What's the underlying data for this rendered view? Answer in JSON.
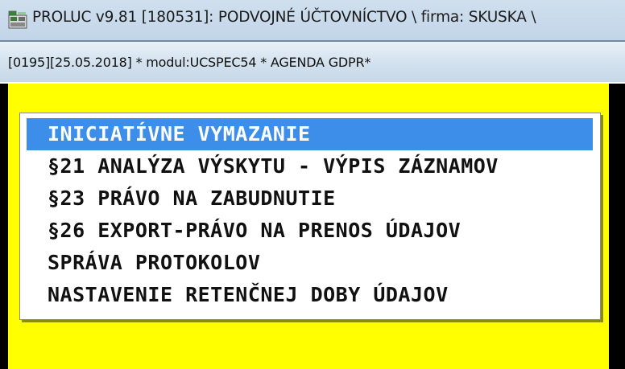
{
  "window": {
    "title": "PROLUC v9.81 [180531]: PODVOJNÉ ÚČTOVNÍCTVO \\ firma: SKUSKA \\",
    "icon": "app-icon"
  },
  "status": {
    "text": "[0195][25.05.2018] * modul:UCSPEC54 * AGENDA GDPR*"
  },
  "menu": {
    "selected_index": 0,
    "items": [
      {
        "label": "INICIATÍVNE VYMAZANIE"
      },
      {
        "label": "§21 ANALÝZA VÝSKYTU - VÝPIS ZÁZNAMOV"
      },
      {
        "label": "§23 PRÁVO NA ZABUDNUTIE"
      },
      {
        "label": "§26 EXPORT-PRÁVO NA PRENOS ÚDAJOV"
      },
      {
        "label": "SPRÁVA PROTOKOLOV"
      },
      {
        "label": "NASTAVENIE RETENČNEJ DOBY ÚDAJOV"
      }
    ]
  },
  "colors": {
    "background": "#ffff00",
    "selection": "#3d8ee8",
    "titlebar": "#c8dae9"
  }
}
